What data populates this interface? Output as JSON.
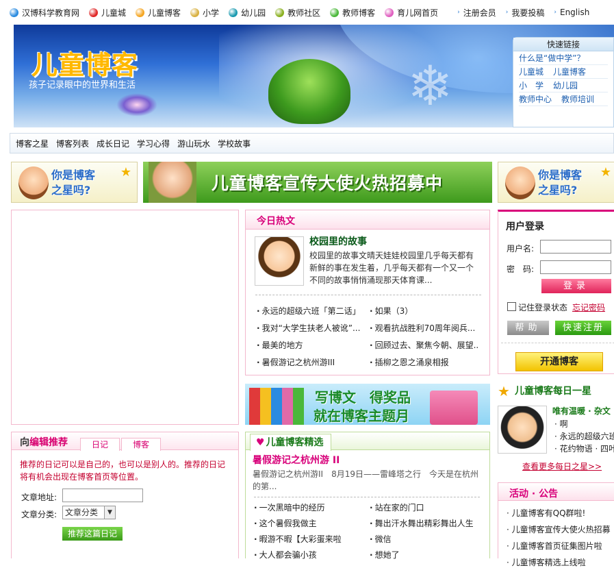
{
  "topnav": {
    "left": [
      {
        "label": "汉博科学教育网",
        "color": "#2a8be0"
      },
      {
        "label": "儿童城",
        "color": "#e02828"
      },
      {
        "label": "儿童博客",
        "color": "#f5a623"
      },
      {
        "label": "小学",
        "color": "#d8b040"
      },
      {
        "label": "幼儿园",
        "color": "#1a9ab0"
      },
      {
        "label": "教师社区",
        "color": "#8ab020"
      },
      {
        "label": "教师博客",
        "color": "#4ab83a"
      },
      {
        "label": "育儿网首页",
        "color": "#e060c0"
      }
    ],
    "right": [
      "注册会员",
      "我要投稿",
      "English"
    ]
  },
  "banner": {
    "title": "儿童博客",
    "subtitle": "孩子记录眼中的世界和生活",
    "quick_links": {
      "title": "快速链接",
      "rows": [
        [
          "什么是“做中学”？"
        ],
        [
          "儿童城",
          "儿童博客"
        ],
        [
          "小　学",
          "幼儿园"
        ],
        [
          "教师中心",
          "教师培训"
        ]
      ]
    }
  },
  "subnav": [
    "博客之星",
    "博客列表",
    "成长日记",
    "学习心得",
    "游山玩水",
    "学校故事"
  ],
  "ads": {
    "star_text_1": "你是博客",
    "star_text_2": "之星吗?",
    "main_text": "儿童博客宣传大使火热招募中",
    "mid_line1": "写博文　得奖品",
    "mid_line2": "就在博客主题月"
  },
  "recommend": {
    "title_prefix": "向",
    "title_main": "编辑推荐",
    "tabs": [
      "日记",
      "博客"
    ],
    "desc": "推荐的日记可以是自己的，也可以是别人的。推荐的日记将有机会出现在博客首页等位置。",
    "url_label": "文章地址:",
    "url_value": "",
    "cat_label": "文章分类:",
    "cat_value": "文章分类",
    "submit": "推荐这篇日记"
  },
  "hot": {
    "title": "今日热文",
    "story_title": "校园里的故事",
    "story_desc": "校园里的故事文晴天娃娃校园里几乎每天都有新鲜的事在发生着，几乎每天都有一个又一个不同的故事悄悄涌现那天体育课...",
    "links": [
      [
        "永远的超级六班「第二话」",
        "如果（3）"
      ],
      [
        "我对“大学生扶老人被讹”...",
        "观看抗战胜利70周年阅兵..."
      ],
      [
        "最美的地方",
        "回顾过去、聚焦今朝、展望..."
      ],
      [
        "暑假游记之杭州游III",
        "插柳之恩之涌泉相报"
      ]
    ]
  },
  "selected": {
    "tab": "儿童博客精选",
    "title": "暑假游记之杭州游 II",
    "desc": "暑假游记之杭州游II　8月19日——雷峰塔之行　今天是在杭州的第...",
    "links": [
      [
        "一次黑暗中的经历",
        "站在家的门口"
      ],
      [
        "这个暑假我做主",
        "舞出汗水舞出精彩舞出人生"
      ],
      [
        "暇游不暇【大彩蛋来啦",
        "微信"
      ],
      [
        "大人都会骗小孩",
        "想她了"
      ]
    ]
  },
  "login": {
    "title": "用户登录",
    "user_label": "用户名:",
    "pass_label": "密　码:",
    "login_btn": "登录",
    "remember": "记住登录状态",
    "forgot": "忘记密码",
    "help_btn": "帮助",
    "register_btn": "快速注册",
    "open_btn": "开通博客"
  },
  "star_of_day": {
    "title": "儿童博客每日一星",
    "name": "唯有温暖 · 杂文",
    "items": [
      "啊",
      "永远的超级六班",
      "花约物语 · 四叶"
    ],
    "more": "查看更多每日之星>>"
  },
  "activities": {
    "title": "活动 · 公告",
    "items": [
      "儿童博客有QQ群啦!",
      "儿童博客宣传大使火热招募",
      "儿童博客首页征集图片啦",
      "儿童博客精选上线啦"
    ]
  }
}
